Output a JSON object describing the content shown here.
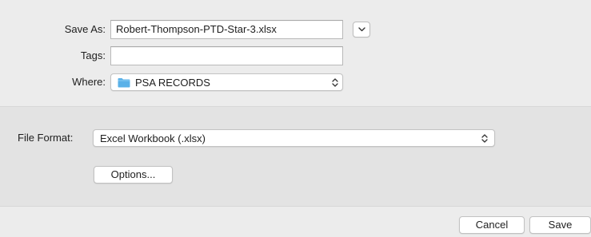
{
  "save_as": {
    "label": "Save As:",
    "value": "Robert-Thompson-PTD-Star-3.xlsx"
  },
  "tags": {
    "label": "Tags:",
    "value": ""
  },
  "where": {
    "label": "Where:",
    "value": "PSA RECORDS",
    "icon": "folder-icon"
  },
  "file_format": {
    "label": "File Format:",
    "value": "Excel Workbook (.xlsx)"
  },
  "options_button": {
    "label": "Options..."
  },
  "buttons": {
    "cancel": "Cancel",
    "save": "Save"
  },
  "colors": {
    "folder": "#5ab1e8",
    "background": "#ececec",
    "panel": "#e3e3e3"
  }
}
